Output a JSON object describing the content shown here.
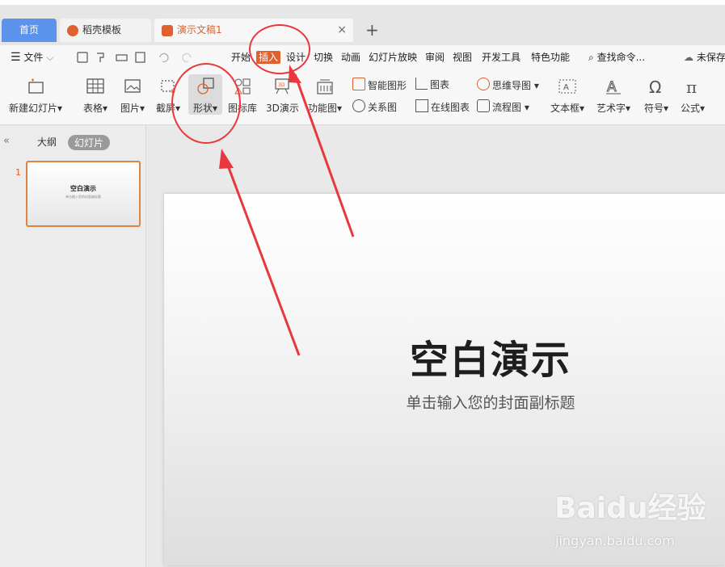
{
  "tabs": {
    "home": "首页",
    "template": "稻壳模板",
    "doc": "演示文稿1",
    "close": "×",
    "add": "+"
  },
  "menu": {
    "file": "文件",
    "items": [
      "开始",
      "插入",
      "设计",
      "切换",
      "动画",
      "幻灯片放映",
      "审阅",
      "视图",
      "开发工具",
      "特色功能"
    ],
    "search": "查找命令...",
    "unsaved": "未保存"
  },
  "ribbon": {
    "new_slide": "新建幻灯片",
    "table": "表格",
    "picture": "图片",
    "screenshot": "截屏",
    "shape": "形状",
    "icon_lib": "图标库",
    "demo3d": "3D演示",
    "function_chart": "功能图",
    "smart_art": "智能图形",
    "chart": "图表",
    "relation": "关系图",
    "online_chart": "在线图表",
    "mind_map": "思维导图",
    "flowchart": "流程图",
    "textbox": "文本框",
    "wordart": "艺术字",
    "symbol": "符号",
    "formula": "公式"
  },
  "panel": {
    "collapse": "«",
    "outline": "大纲",
    "slides": "幻灯片",
    "slide_number": "1",
    "thumb_title": "空白演示",
    "thumb_sub": "单击输入您的封面副标题"
  },
  "slide": {
    "title": "空白演示",
    "subtitle": "单击输入您的封面副标题"
  },
  "watermark": {
    "brand": "Baidu经验",
    "url": "jingyan.baidu.com"
  },
  "colors": {
    "accent": "#e0612d",
    "home_tab": "#5b93ed",
    "annotation": "#e8383d"
  }
}
